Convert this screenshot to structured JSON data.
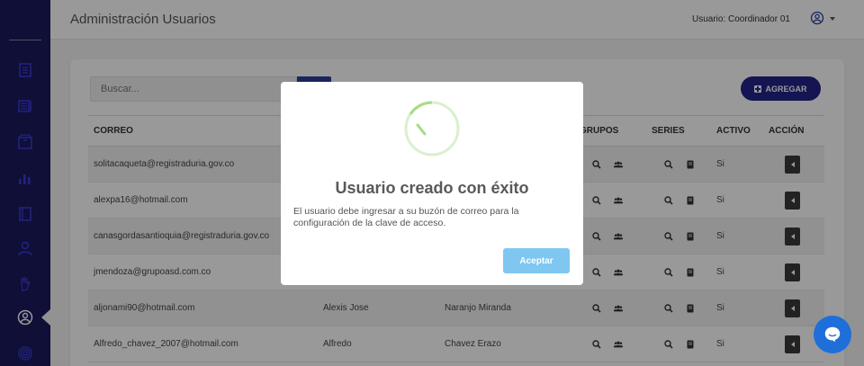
{
  "header": {
    "title": "Administración Usuarios",
    "user_label": "Usuario: Coordinador 01"
  },
  "toolbar": {
    "search_placeholder": "Buscar...",
    "add_label": "AGREGAR"
  },
  "table": {
    "columns": [
      "CORREO",
      "",
      "",
      "GRUPOS",
      "SERIES",
      "ACTIVO",
      "ACCIÓN"
    ],
    "rows": [
      {
        "correo": "solitacaqueta@registraduria.gov.co",
        "nombre": "",
        "apellido": "",
        "activo": "Si"
      },
      {
        "correo": "alexpa16@hotmail.com",
        "nombre": "",
        "apellido": "",
        "activo": "Si"
      },
      {
        "correo": "canasgordasantioquia@registraduria.gov.co",
        "nombre": "",
        "apellido": "",
        "activo": "Si"
      },
      {
        "correo": "jmendoza@grupoasd.com.co",
        "nombre": "",
        "apellido": "",
        "activo": "Si"
      },
      {
        "correo": "aljonami90@hotmail.com",
        "nombre": "Alexis Jose",
        "apellido": "Naranjo Miranda",
        "activo": "Si"
      },
      {
        "correo": "Alfredo_chavez_2007@hotmail.com",
        "nombre": "Alfredo",
        "apellido": "Chavez Erazo",
        "activo": "Si"
      }
    ]
  },
  "modal": {
    "title": "Usuario creado con éxito",
    "text": "El usuario debe ingresar a su buzón de correo para la configuración de la clave de acceso.",
    "ok_label": "Aceptar"
  },
  "colors": {
    "sidebar": "#1a1a5e",
    "primary": "#23238a",
    "ok_button": "#7fc7f1",
    "success_ring": "#a5dc86",
    "chat": "#1e6fd9"
  },
  "icons": {
    "sidebar": [
      "list-icon",
      "list-alt-icon",
      "box-icon",
      "chart-icon",
      "book-icon",
      "user-icon",
      "hand-icon",
      "user-circle-icon",
      "fingerprint-icon"
    ],
    "table_grupos": [
      "search-icon",
      "users-icon"
    ],
    "table_series": [
      "search-icon",
      "book-icon"
    ],
    "table_accion": "caret-left-icon",
    "chat": "chat-icon"
  }
}
